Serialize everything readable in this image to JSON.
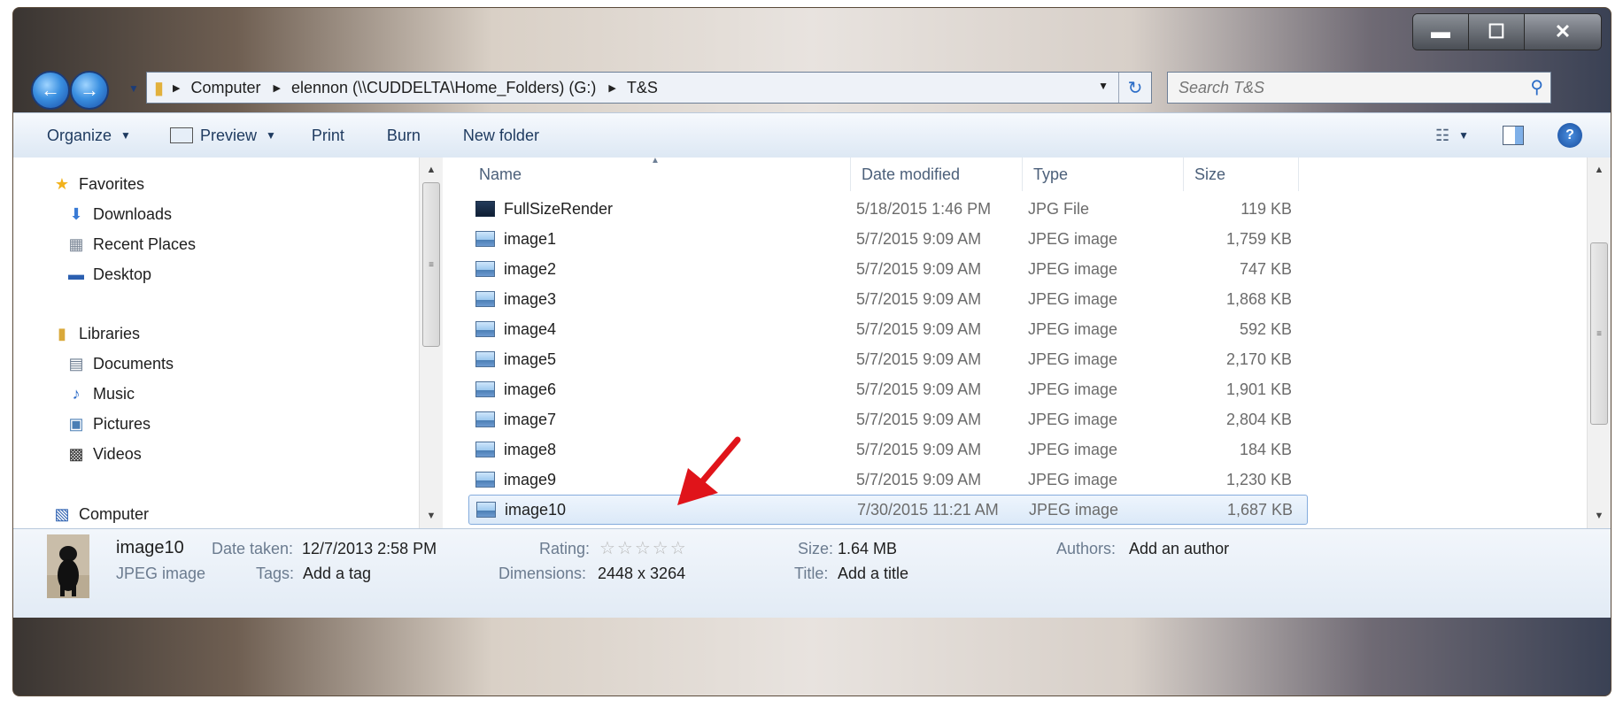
{
  "window": {
    "caption_buttons": {
      "minimize": "▬",
      "maximize": "☐",
      "close": "✕"
    }
  },
  "address_bar": {
    "crumbs": [
      "Computer",
      "elennon (\\\\CUDDELTA\\Home_Folders) (G:)",
      "T&S"
    ],
    "search_placeholder": "Search T&S"
  },
  "toolbar": {
    "organize": "Organize",
    "preview": "Preview",
    "print": "Print",
    "burn": "Burn",
    "new_folder": "New folder"
  },
  "nav_pane": {
    "favorites": "Favorites",
    "downloads": "Downloads",
    "recent_places": "Recent Places",
    "desktop": "Desktop",
    "libraries": "Libraries",
    "documents": "Documents",
    "music": "Music",
    "pictures": "Pictures",
    "videos": "Videos",
    "computer": "Computer"
  },
  "columns": {
    "name": "Name",
    "date": "Date modified",
    "type": "Type",
    "size": "Size"
  },
  "files": [
    {
      "name": "FullSizeRender",
      "date": "5/18/2015 1:46 PM",
      "type": "JPG File",
      "size": "119 KB"
    },
    {
      "name": "image1",
      "date": "5/7/2015 9:09 AM",
      "type": "JPEG image",
      "size": "1,759 KB"
    },
    {
      "name": "image2",
      "date": "5/7/2015 9:09 AM",
      "type": "JPEG image",
      "size": "747 KB"
    },
    {
      "name": "image3",
      "date": "5/7/2015 9:09 AM",
      "type": "JPEG image",
      "size": "1,868 KB"
    },
    {
      "name": "image4",
      "date": "5/7/2015 9:09 AM",
      "type": "JPEG image",
      "size": "592 KB"
    },
    {
      "name": "image5",
      "date": "5/7/2015 9:09 AM",
      "type": "JPEG image",
      "size": "2,170 KB"
    },
    {
      "name": "image6",
      "date": "5/7/2015 9:09 AM",
      "type": "JPEG image",
      "size": "1,901 KB"
    },
    {
      "name": "image7",
      "date": "5/7/2015 9:09 AM",
      "type": "JPEG image",
      "size": "2,804 KB"
    },
    {
      "name": "image8",
      "date": "5/7/2015 9:09 AM",
      "type": "JPEG image",
      "size": "184 KB"
    },
    {
      "name": "image9",
      "date": "5/7/2015 9:09 AM",
      "type": "JPEG image",
      "size": "1,230 KB"
    },
    {
      "name": "image10",
      "date": "7/30/2015 11:21 AM",
      "type": "JPEG image",
      "size": "1,687 KB",
      "selected": true
    }
  ],
  "details": {
    "file_name": "image10",
    "file_type": "JPEG image",
    "date_taken_label": "Date taken:",
    "date_taken": "12/7/2013 2:58 PM",
    "tags_label": "Tags:",
    "tags": "Add a tag",
    "rating_label": "Rating:",
    "rating_stars": "☆☆☆☆☆",
    "dimensions_label": "Dimensions:",
    "dimensions": "2448 x 3264",
    "size_label": "Size:",
    "size": "1.64 MB",
    "title_label": "Title:",
    "title": "Add a title",
    "authors_label": "Authors:",
    "authors": "Add an author"
  },
  "colors": {
    "accent": "#2a6cc7",
    "selection": "#dbe9f8",
    "arrow": "#e0141a"
  }
}
